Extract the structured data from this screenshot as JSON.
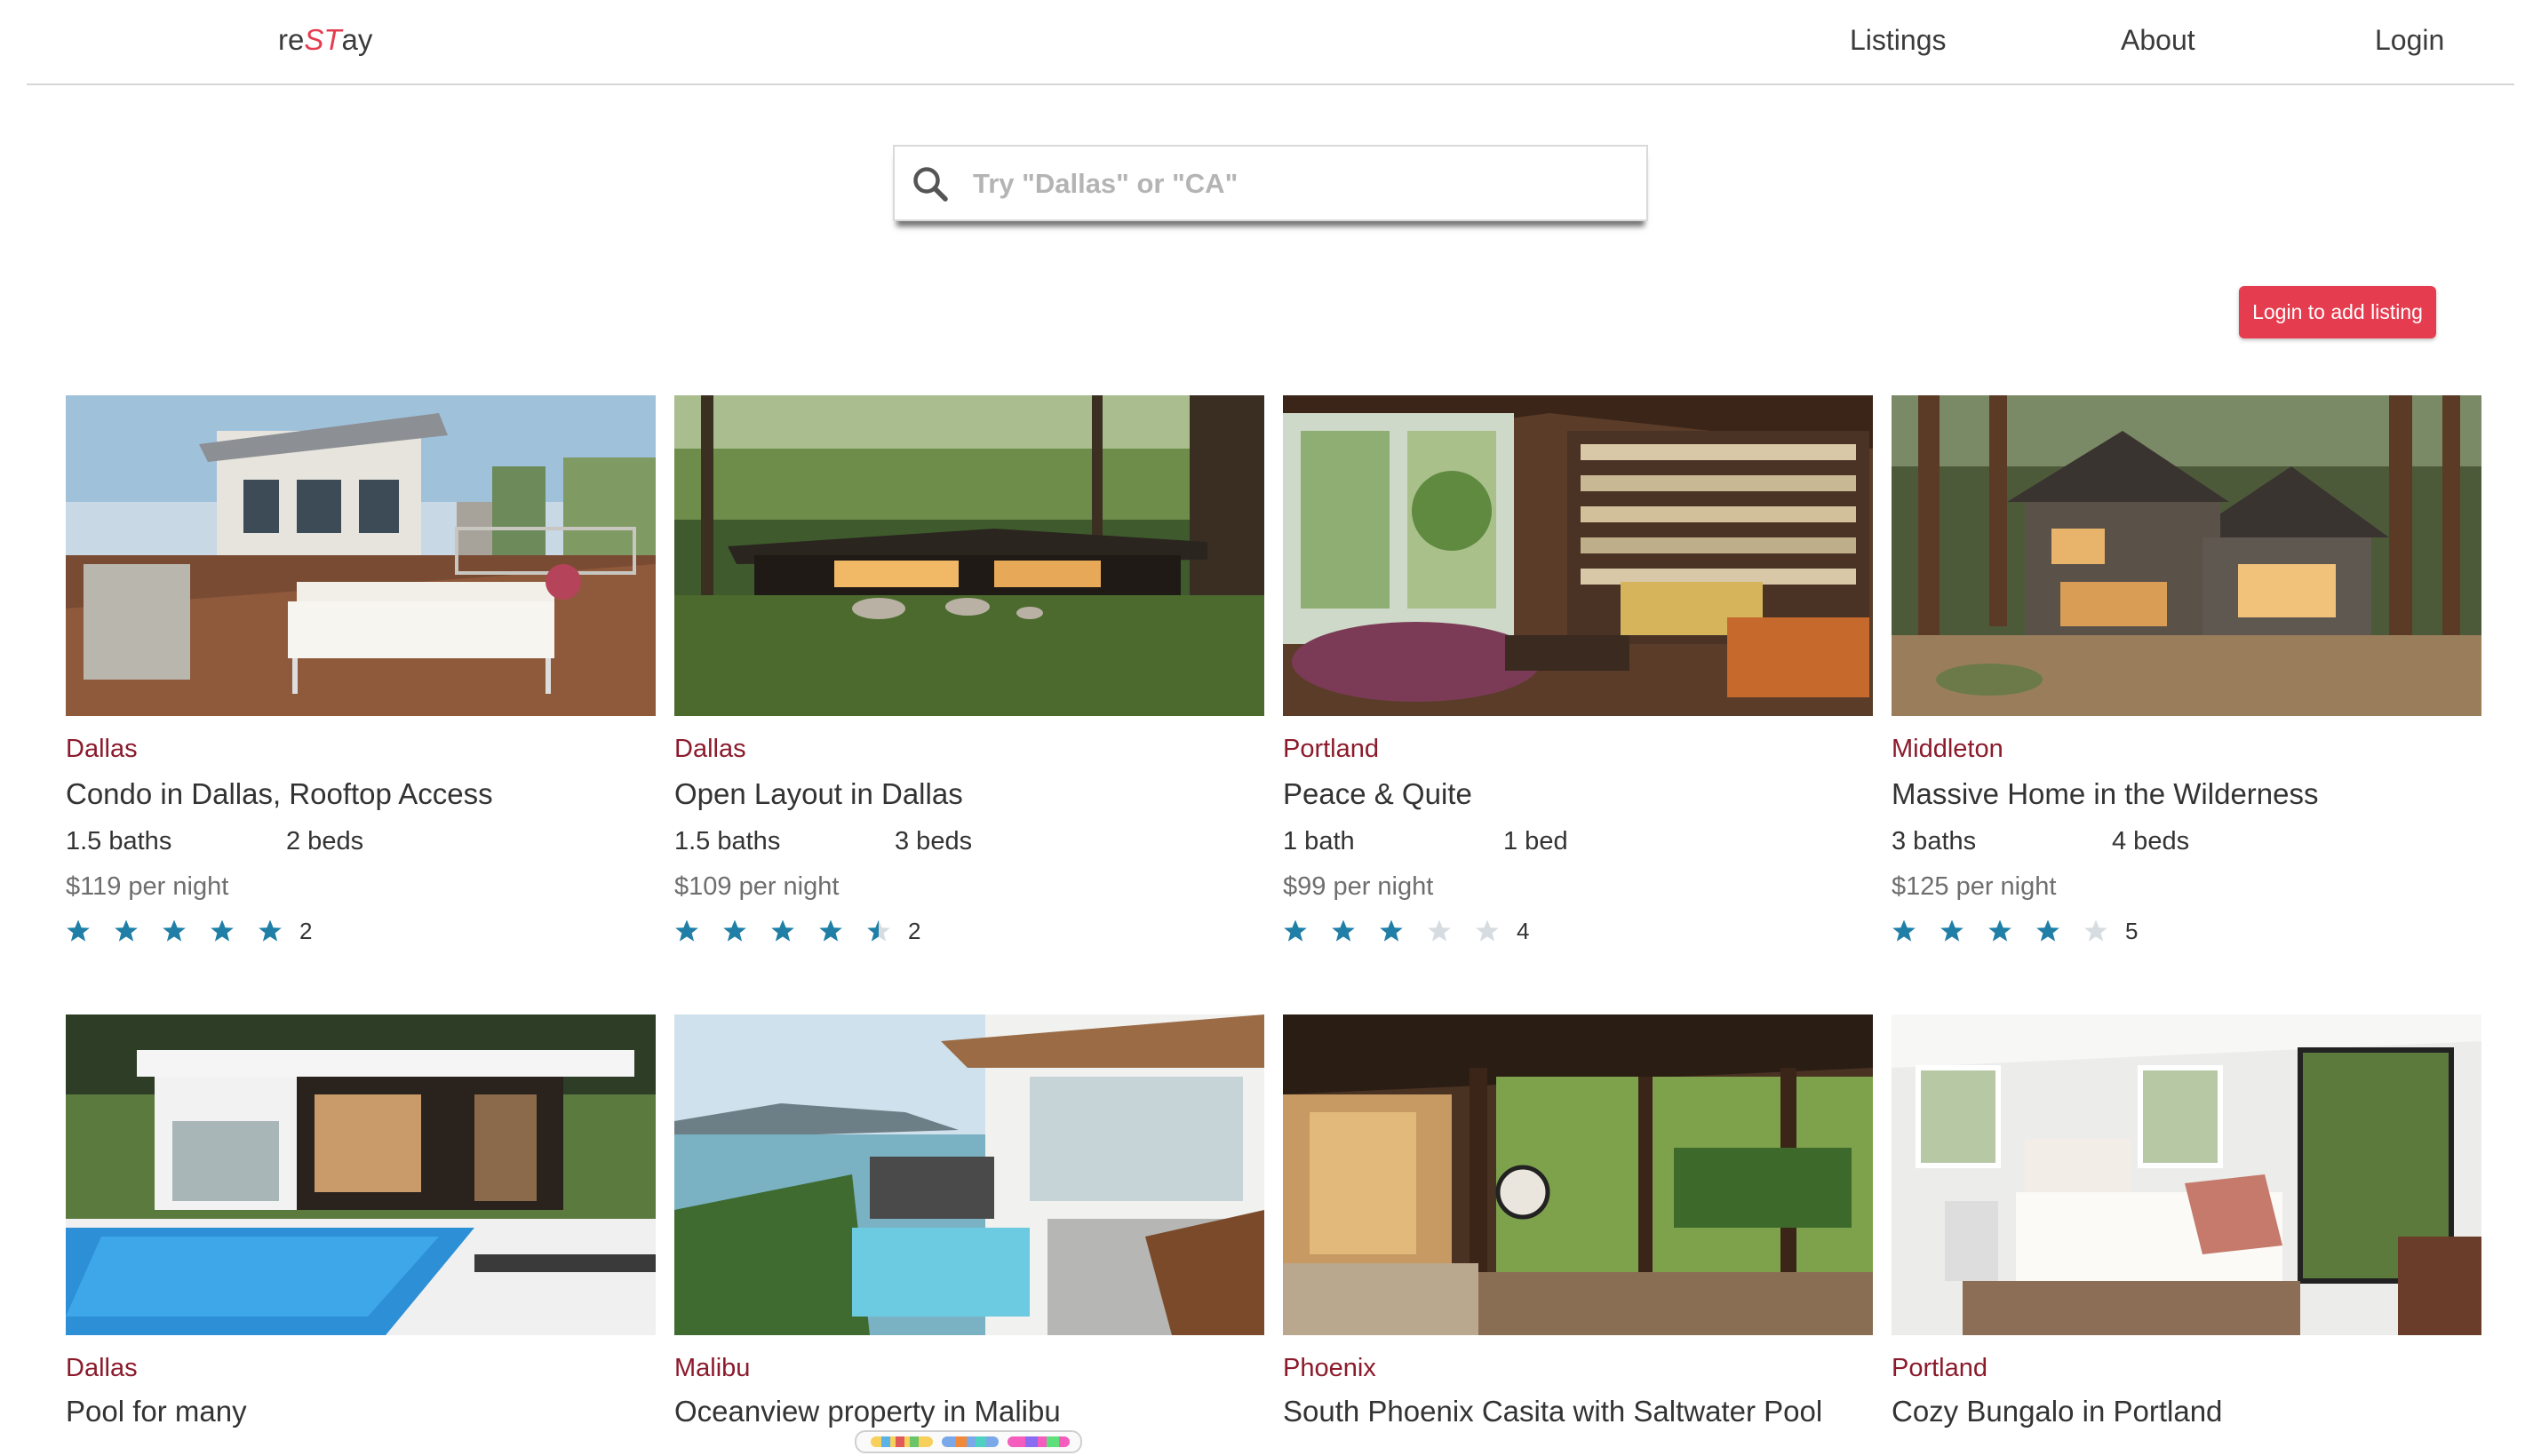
{
  "brand": {
    "prefix": "re",
    "highlight": "ST",
    "suffix": "ay"
  },
  "nav": {
    "listings": "Listings",
    "about": "About",
    "login": "Login"
  },
  "search": {
    "placeholder": "Try \"Dallas\" or \"CA\"",
    "value": ""
  },
  "add_listing_button": "Login to add listing",
  "colors": {
    "accent": "#e53d4f",
    "city": "#8b1a2b",
    "star": "#1f7fa6",
    "star_empty": "#d7dce0"
  },
  "listings": [
    {
      "city": "Dallas",
      "title": "Condo in Dallas, Rooftop Access",
      "baths": "1.5 baths",
      "beds": "2 beds",
      "price": "$119 per night",
      "rating": 5,
      "reviews": "2"
    },
    {
      "city": "Dallas",
      "title": "Open Layout in Dallas",
      "baths": "1.5 baths",
      "beds": "3 beds",
      "price": "$109 per night",
      "rating": 4.5,
      "reviews": "2"
    },
    {
      "city": "Portland",
      "title": "Peace & Quite",
      "baths": "1 bath",
      "beds": "1 bed",
      "price": "$99 per night",
      "rating": 3,
      "reviews": "4"
    },
    {
      "city": "Middleton",
      "title": "Massive Home in the Wilderness",
      "baths": "3 baths",
      "beds": "4 beds",
      "price": "$125 per night",
      "rating": 4,
      "reviews": "5"
    },
    {
      "city": "Dallas",
      "title": "Pool for many"
    },
    {
      "city": "Malibu",
      "title": "Oceanview property in Malibu"
    },
    {
      "city": "Phoenix",
      "title": "South Phoenix Casita with Saltwater Pool"
    },
    {
      "city": "Portland",
      "title": "Cozy Bungalo in Portland"
    }
  ]
}
